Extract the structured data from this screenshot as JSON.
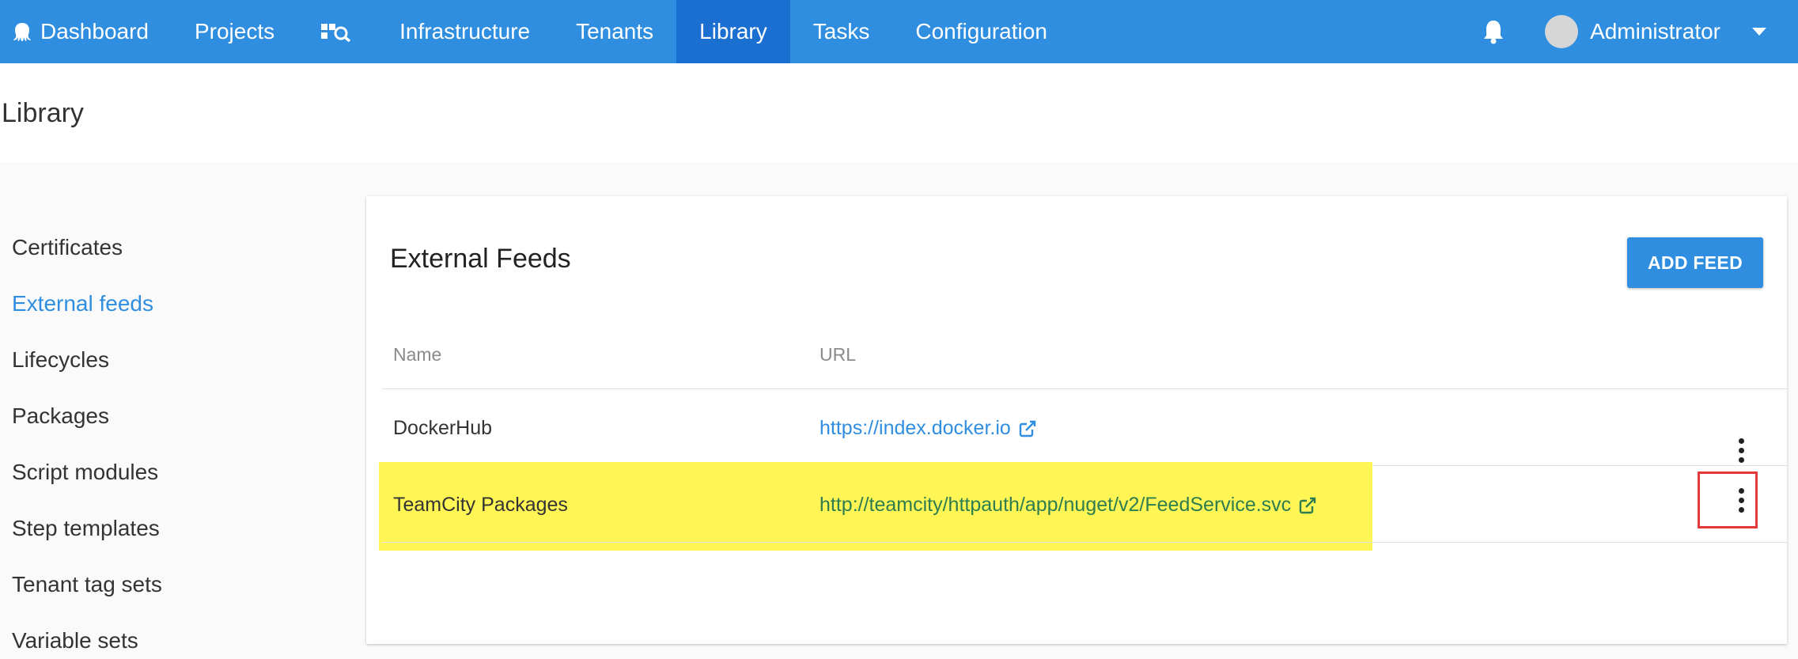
{
  "nav": {
    "items": [
      {
        "label": "Dashboard",
        "icon": "octopus-icon"
      },
      {
        "label": "Projects"
      },
      {
        "label": "",
        "icon": "search-dashboard-icon"
      },
      {
        "label": "Infrastructure"
      },
      {
        "label": "Tenants"
      },
      {
        "label": "Library",
        "active": true
      },
      {
        "label": "Tasks"
      },
      {
        "label": "Configuration"
      }
    ],
    "user": "Administrator",
    "bell_icon": "bell-icon"
  },
  "page": {
    "title": "Library"
  },
  "sidebar": {
    "items": [
      {
        "label": "Certificates"
      },
      {
        "label": "External feeds",
        "active": true
      },
      {
        "label": "Lifecycles"
      },
      {
        "label": "Packages"
      },
      {
        "label": "Script modules"
      },
      {
        "label": "Step templates"
      },
      {
        "label": "Tenant tag sets"
      },
      {
        "label": "Variable sets"
      }
    ]
  },
  "card": {
    "title": "External Feeds",
    "add_button": "ADD FEED",
    "columns": [
      "Name",
      "URL"
    ],
    "rows": [
      {
        "name": "DockerHub",
        "url": "https://index.docker.io"
      },
      {
        "name": "TeamCity Packages",
        "url": "http://teamcity/httpauth/app/nuget/v2/FeedService.svc",
        "highlighted": true
      }
    ]
  },
  "colors": {
    "nav_bg": "#2f8ee0",
    "nav_active": "#1a6fd0",
    "link_blue": "#2f8ee0",
    "link_green": "#2e7d4f",
    "highlight": "#fff555",
    "annotation_red": "#e53a3a"
  }
}
